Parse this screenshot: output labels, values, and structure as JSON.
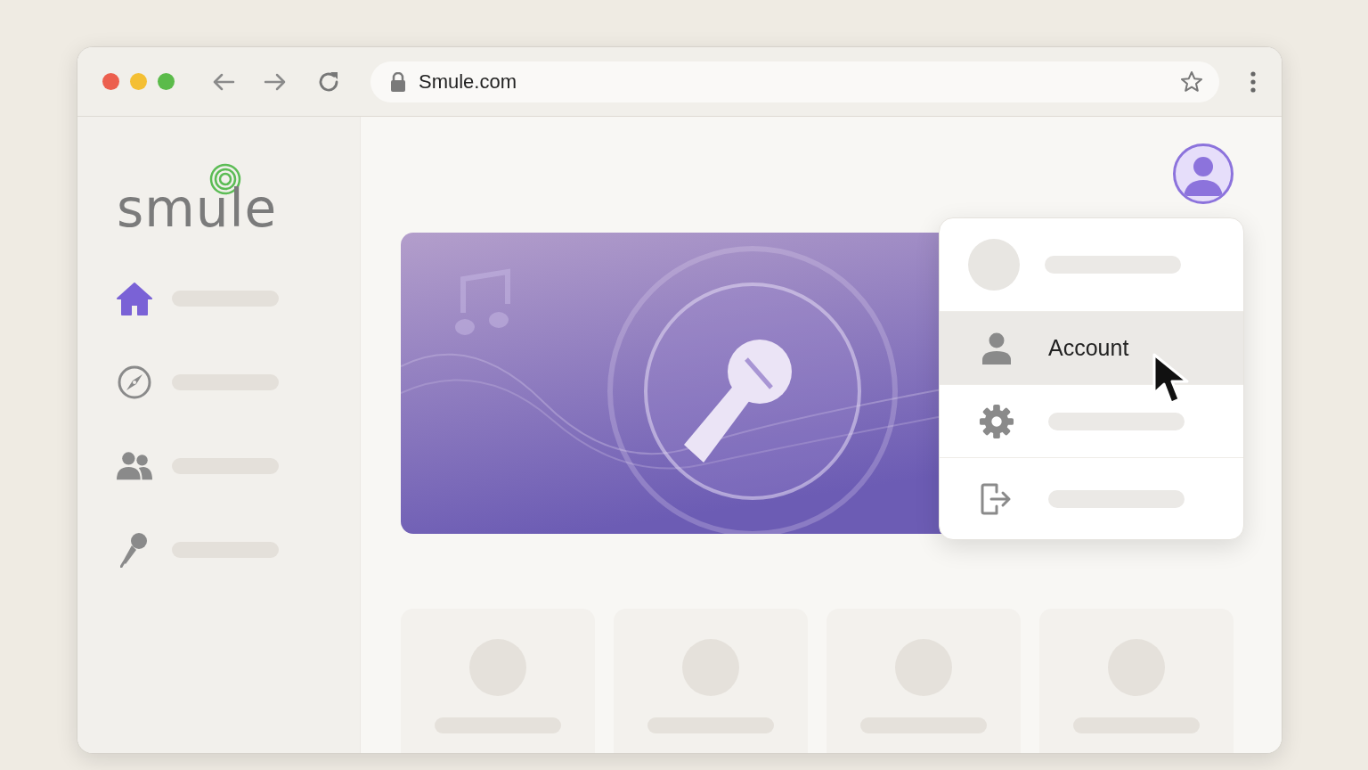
{
  "browser": {
    "url": "Smule.com"
  },
  "sidebar": {
    "logo": "smule",
    "items": [
      {
        "kind": "home",
        "selected": true
      },
      {
        "kind": "compass",
        "selected": false
      },
      {
        "kind": "people",
        "selected": false
      },
      {
        "kind": "mic",
        "selected": false
      }
    ]
  },
  "profile_menu": {
    "items": [
      {
        "kind": "profile",
        "selected": false
      },
      {
        "kind": "account",
        "label": "Account",
        "selected": true
      },
      {
        "kind": "settings",
        "selected": false
      },
      {
        "kind": "logout",
        "selected": false
      }
    ]
  }
}
